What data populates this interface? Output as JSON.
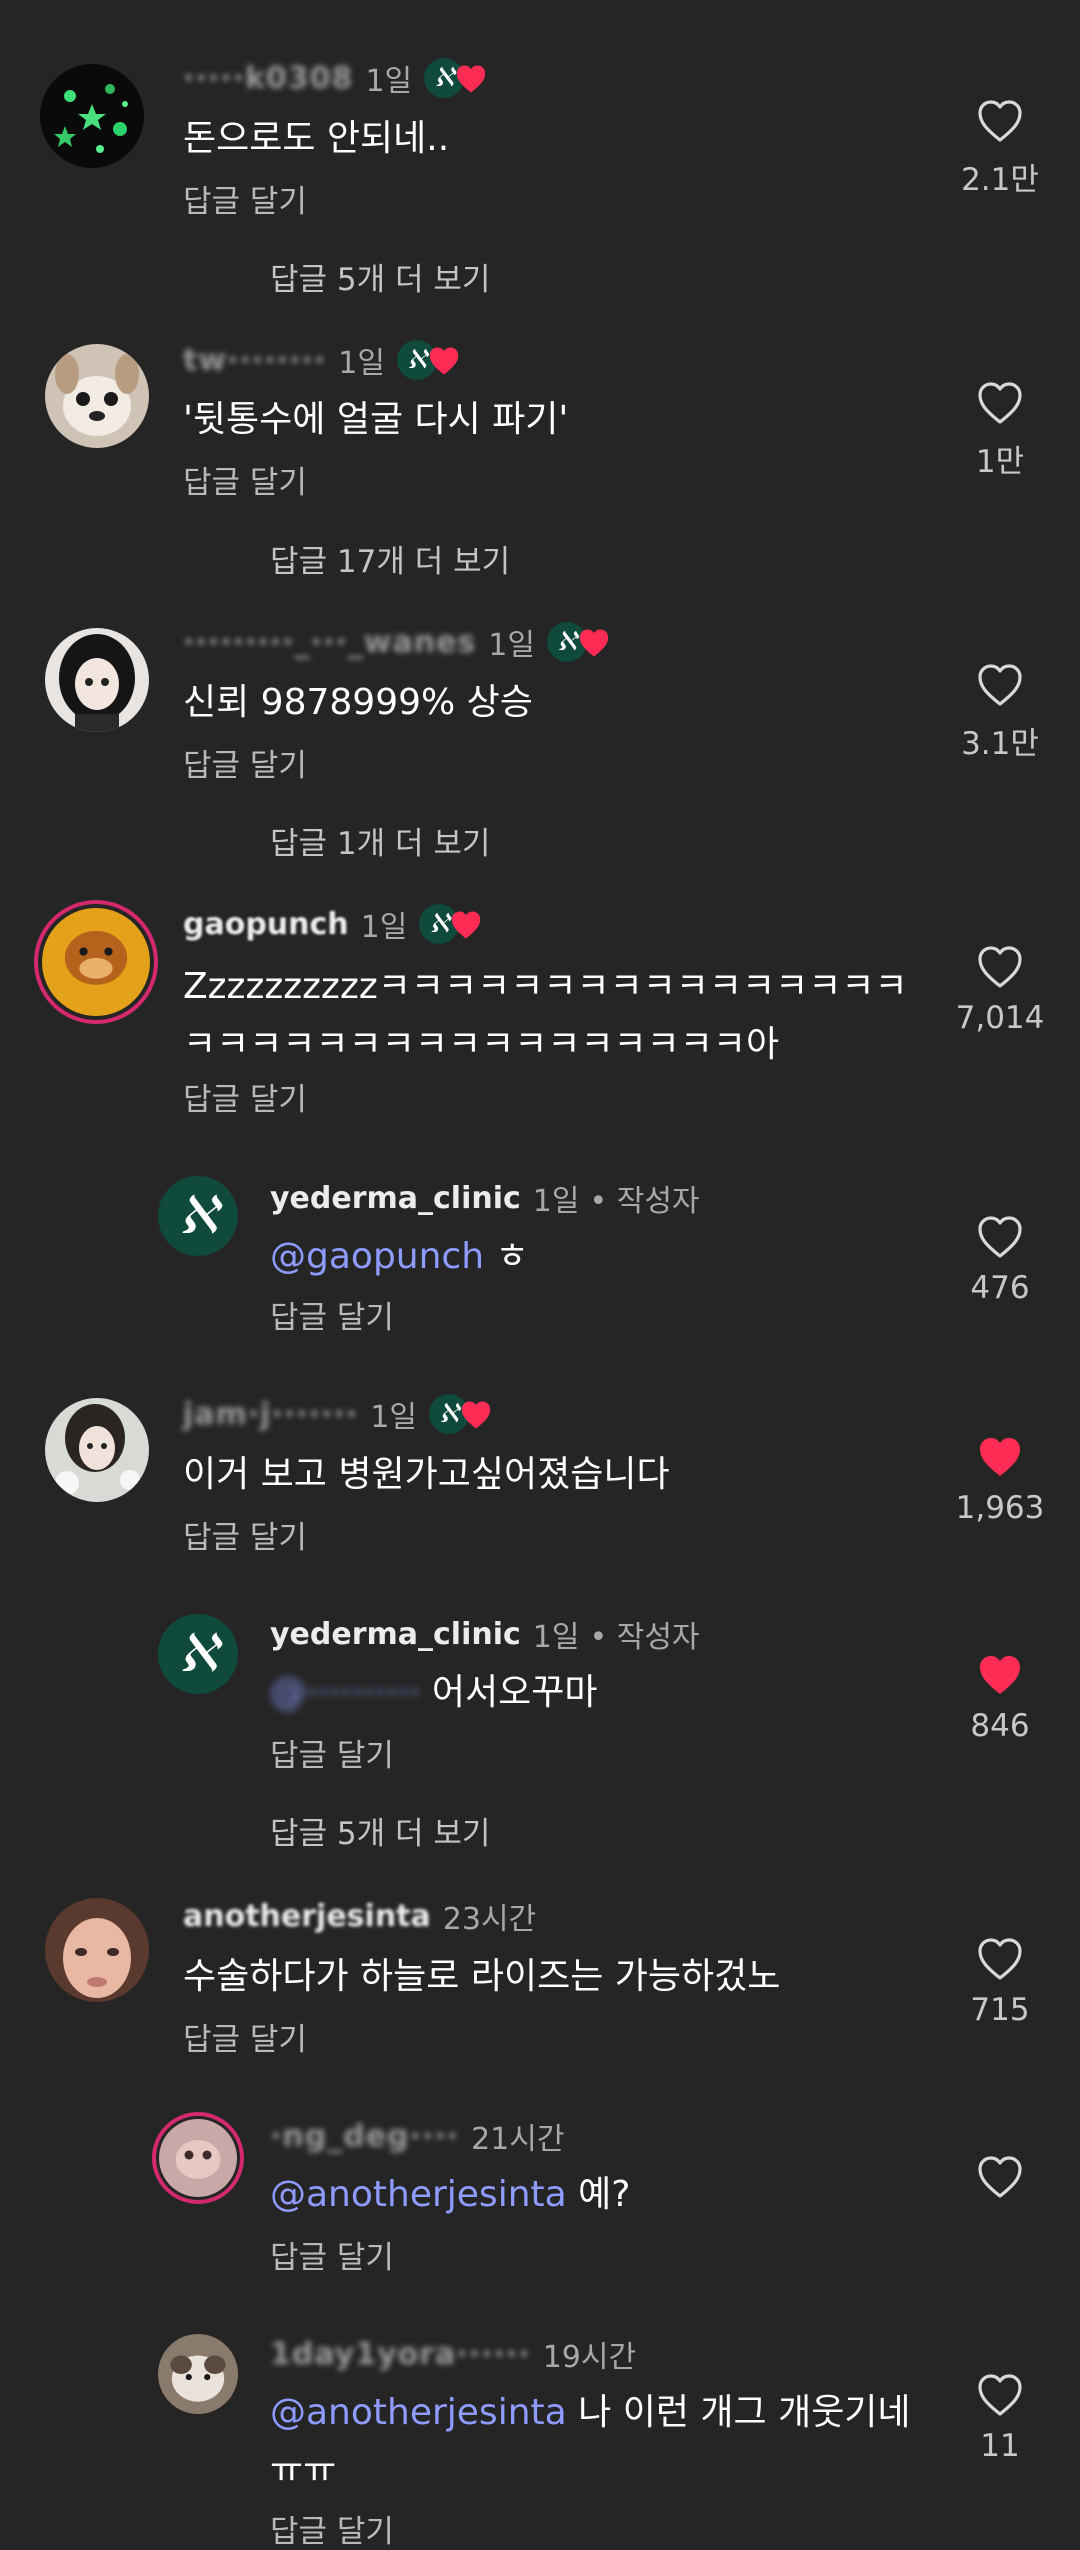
{
  "colors": {
    "background": "#252525",
    "liked_heart": "#fe2c55",
    "mention": "#8e9bff",
    "clinic_badge": "#0f4a3c"
  },
  "reply_label": "답글 달기",
  "comments": [
    {
      "username": "·····k0308",
      "time": "1일",
      "text": "돈으로도 안되네..",
      "likes": "2.1만",
      "liked": false,
      "more": "답글 5개 더 보기"
    },
    {
      "username": "tw········",
      "time": "1일",
      "text": "'뒷통수에 얼굴 다시 파기'",
      "likes": "1만",
      "liked": false,
      "more": "답글 17개 더 보기"
    },
    {
      "username": "·········_···_wanes",
      "time": "1일",
      "text": "신뢰 9878999% 상승",
      "likes": "3.1만",
      "liked": false,
      "more": "답글 1개 더 보기"
    },
    {
      "username": "gaopunch",
      "time": "1일",
      "text": "Zzzzzzzzzzㅋㅋㅋㅋㅋㅋㅋㅋㅋㅋㅋㅋㅋㅋㅋㅋㅋㅋㅋㅋㅋㅋㅋㅋㅋㅋㅋㅋㅋㅋㅋㅋㅋ아",
      "likes": "7,014",
      "liked": false
    },
    {
      "username": "yederma_clinic",
      "time": "1일",
      "creator": "• 작성자",
      "mention": "@gaopunch",
      "text": "ㅎ",
      "likes": "476",
      "liked": false
    },
    {
      "username": "jam·j·······",
      "time": "1일",
      "text": "이거 보고 병원가고싶어졌습니다",
      "likes": "1,963",
      "liked": true
    },
    {
      "username": "yederma_clinic",
      "time": "1일",
      "creator": "• 작성자",
      "mention": "@··········",
      "text": "어서오꾸마",
      "likes": "846",
      "liked": true,
      "more": "답글 5개 더 보기"
    },
    {
      "username": "anotherjesinta",
      "time": "23시간",
      "text": "수술하다가 하늘로 라이즈는 가능하겄노",
      "likes": "715",
      "liked": false
    },
    {
      "username": "·ng_deg····",
      "time": "21시간",
      "mention": "@anotherjesinta",
      "text": "예?",
      "likes": "",
      "liked": false
    },
    {
      "username": "1day1yora······",
      "time": "19시간",
      "mention": "@anotherjesinta",
      "text": "나 이런 개그 개웃기네 ㅠㅠ",
      "likes": "11",
      "liked": false
    }
  ]
}
